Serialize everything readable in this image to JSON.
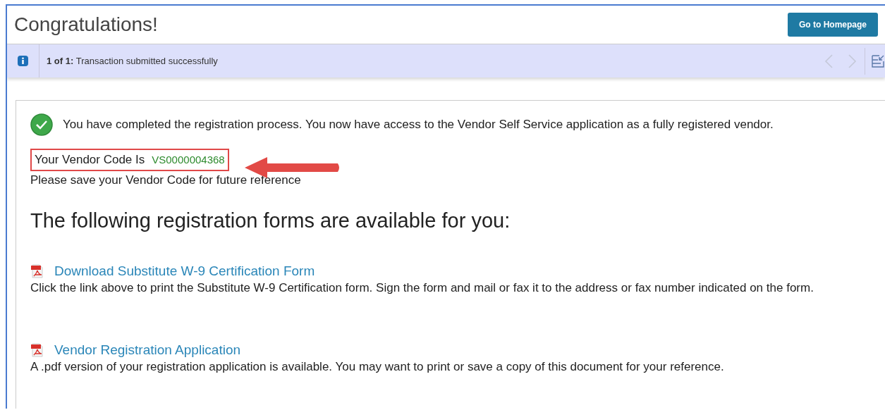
{
  "header": {
    "title": "Congratulations!",
    "button": "Go to Homepage"
  },
  "message_bar": {
    "counter": "1 of 1:",
    "text": "Transaction submitted successfully",
    "prev_disabled": true,
    "next_disabled": true
  },
  "success_message": "You have completed the registration process. You now have access to the Vendor Self Service application as a fully registered vendor.",
  "vendor_code": {
    "label": "Your Vendor Code Is",
    "value": "VS0000004368",
    "highlighted": true
  },
  "save_note": "Please save your Vendor Code for future reference",
  "forms_heading": "The following registration forms are available for you:",
  "forms": [
    {
      "link": "Download Substitute W-9 Certification Form",
      "description": "Click the link above to print the Substitute W-9 Certification form. Sign the form and mail or fax it to the address or fax number indicated on the form."
    },
    {
      "link": "Vendor Registration Application",
      "description": "A .pdf version of your registration application is available. You may want to print or save a copy of this document for your reference."
    }
  ]
}
